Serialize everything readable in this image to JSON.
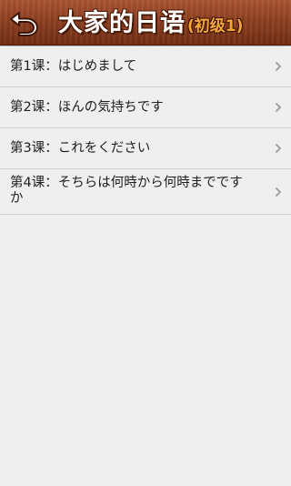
{
  "header": {
    "title": "大家的日语",
    "subtitle": "(初级1)",
    "back_icon": "back-arrow-icon"
  },
  "lessons": [
    {
      "label": "第1课：はじめまして"
    },
    {
      "label": "第2课：ほんの気持ちです"
    },
    {
      "label": "第3课：これをください"
    },
    {
      "label": "第4课：そちらは何時から何時までですか"
    }
  ],
  "colors": {
    "header_top": "#a8532f",
    "header_bottom": "#6f2c12",
    "title_text": "#ffffff",
    "subtitle_text": "#f4a63a",
    "background": "#efefef",
    "divider": "#d2d2d2",
    "chevron": "#9a9a9a"
  }
}
